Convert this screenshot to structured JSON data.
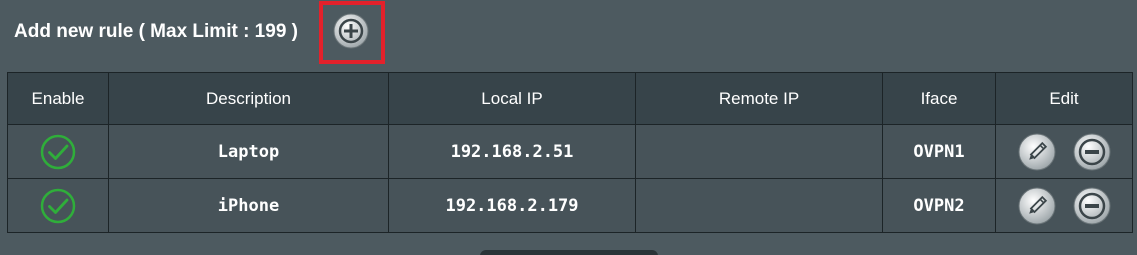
{
  "header": {
    "title": "Add new rule ( Max Limit : 199 )"
  },
  "table": {
    "columns": [
      "Enable",
      "Description",
      "Local IP",
      "Remote IP",
      "Iface",
      "Edit"
    ],
    "rows": [
      {
        "enabled": true,
        "description": "Laptop",
        "local_ip": "192.168.2.51",
        "remote_ip": "",
        "iface": "OVPN1"
      },
      {
        "enabled": true,
        "description": "iPhone",
        "local_ip": "192.168.2.179",
        "remote_ip": "",
        "iface": "OVPN2"
      }
    ]
  },
  "colors": {
    "highlight": "#e4212b",
    "check": "#2fae3a",
    "background": "#4d5a60"
  },
  "icons": {
    "add": "plus-circle-icon",
    "enabled": "check-circle-icon",
    "edit": "pencil-icon",
    "delete": "minus-circle-icon"
  }
}
